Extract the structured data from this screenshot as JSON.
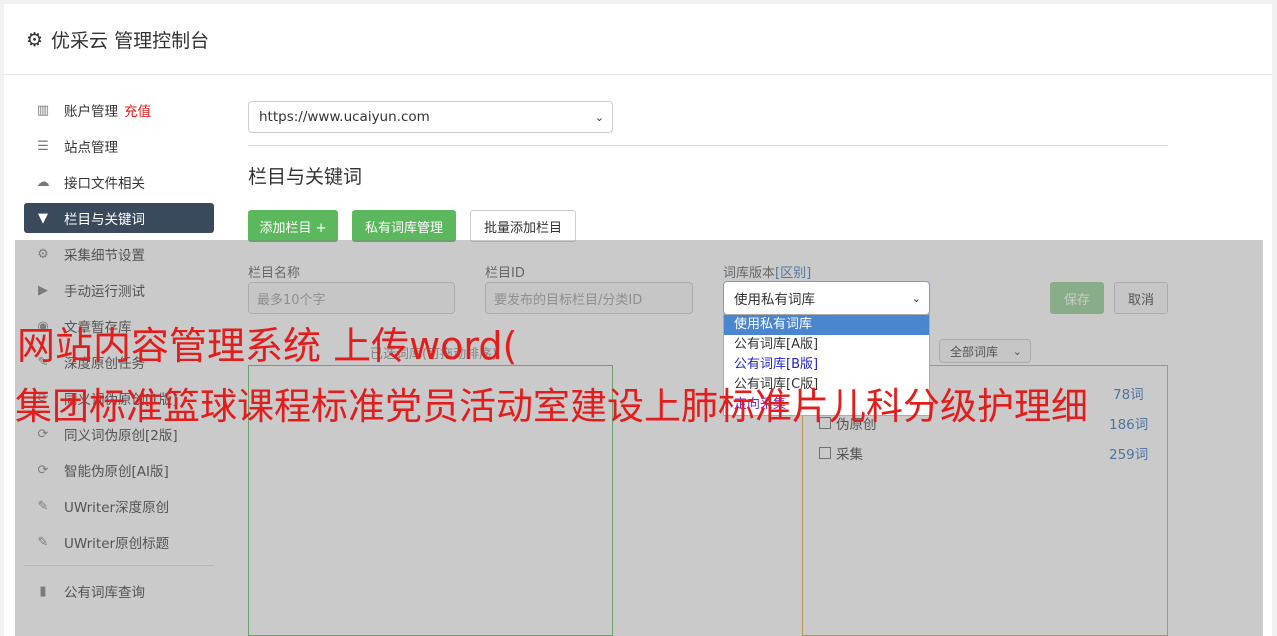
{
  "header": {
    "title": "优采云 管理控制台"
  },
  "sidebar": {
    "items": [
      {
        "label": "账户管理",
        "badge": "充值",
        "icon": "bar-chart-icon"
      },
      {
        "label": "站点管理",
        "icon": "server-icon"
      },
      {
        "label": "接口文件相关",
        "icon": "cloud-upload-icon"
      },
      {
        "label": "栏目与关键词",
        "icon": "filter-icon",
        "active": true
      },
      {
        "label": "采集细节设置",
        "icon": "gears-icon"
      },
      {
        "label": "手动运行测试",
        "icon": "play-circle-icon"
      },
      {
        "label": "文章暂存库",
        "icon": "database-icon"
      },
      {
        "label": "深度原创任务",
        "icon": "edit-icon"
      },
      {
        "label": "同义词伪原创[1版]",
        "icon": "refresh-icon"
      },
      {
        "label": "同义词伪原创[2版]",
        "icon": "refresh-icon"
      },
      {
        "label": "智能伪原创[AI版]",
        "icon": "refresh-icon"
      },
      {
        "label": "UWriter深度原创",
        "icon": "edit-icon"
      },
      {
        "label": "UWriter原创标题",
        "icon": "edit-icon"
      }
    ],
    "bottom_items": [
      {
        "label": "公有词库查询",
        "icon": "book-icon"
      }
    ]
  },
  "main": {
    "site_select": {
      "value": "https://www.ucaiyun.com"
    },
    "section_title": "栏目与关键词",
    "buttons": {
      "add_column": "添加栏目 +",
      "private_lib": "私有词库管理",
      "batch_add": "批量添加栏目"
    },
    "form": {
      "column_name_label": "栏目名称",
      "column_name_placeholder": "最多10个字",
      "column_id_label": "栏目ID",
      "column_id_placeholder": "要发布的目标栏目/分类ID",
      "lib_version_label": "词库版本",
      "lib_version_link": "[区别]",
      "lib_version_value": "使用私有词库",
      "save": "保存",
      "cancel": "取消"
    },
    "dropdown_options": [
      "使用私有词库",
      "公有词库[A版]",
      "公有词库[B版]",
      "公有词库[C版]",
      "定向采集"
    ],
    "selected_label": "已选词库(可拖动排序)",
    "all_libs_select": "全部词库",
    "lib_list": [
      {
        "name": "伪原创",
        "count": "186词"
      },
      {
        "name": "采集",
        "count": "259词"
      }
    ],
    "partial_count": "78词"
  },
  "watermark": {
    "line1": "网站内容管理系统 上传word(",
    "line2": "集团标准篮球课程标准党员活动室建设上肺标准片儿科分级护理细"
  }
}
